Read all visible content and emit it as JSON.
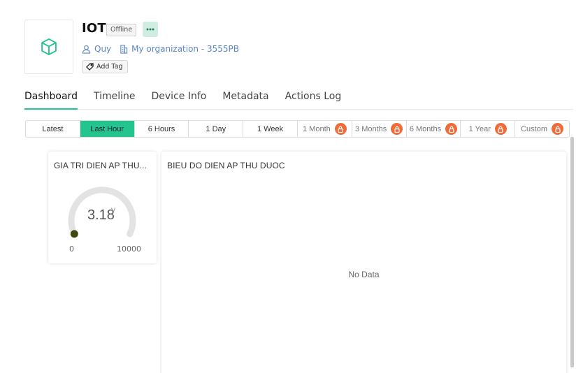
{
  "device": {
    "name": "IOT",
    "status": "Offline",
    "owner": "Quy",
    "organization": "My organization - 3555PB",
    "add_tag_label": "Add Tag"
  },
  "tabs": [
    {
      "label": "Dashboard",
      "active": true
    },
    {
      "label": "Timeline",
      "active": false
    },
    {
      "label": "Device Info",
      "active": false
    },
    {
      "label": "Metadata",
      "active": false
    },
    {
      "label": "Actions Log",
      "active": false
    }
  ],
  "time_range": [
    {
      "label": "Latest",
      "active": false,
      "locked": false
    },
    {
      "label": "Last Hour",
      "active": true,
      "locked": false
    },
    {
      "label": "6 Hours",
      "active": false,
      "locked": false
    },
    {
      "label": "1 Day",
      "active": false,
      "locked": false
    },
    {
      "label": "1 Week",
      "active": false,
      "locked": false
    },
    {
      "label": "1 Month",
      "active": false,
      "locked": true
    },
    {
      "label": "3 Months",
      "active": false,
      "locked": true
    },
    {
      "label": "6 Months",
      "active": false,
      "locked": true
    },
    {
      "label": "1 Year",
      "active": false,
      "locked": true
    },
    {
      "label": "Custom",
      "active": false,
      "locked": true
    }
  ],
  "widgets": {
    "gauge": {
      "title": "GIA TRI DIEN AP THU...",
      "value": "3.18",
      "unit": "V",
      "min": "0",
      "max": "10000"
    },
    "chart": {
      "title": "BIEU DO DIEN AP THU DUOC",
      "empty_text": "No Data"
    }
  },
  "colors": {
    "accent": "#23c48e",
    "lock": "#f06b3a",
    "link": "#5a86c8"
  },
  "icons": {
    "device": "cube-icon",
    "owner": "user-icon",
    "organization": "building-icon",
    "tag": "tag-icon",
    "lock": "lock-icon",
    "more": "more-dots-icon"
  }
}
